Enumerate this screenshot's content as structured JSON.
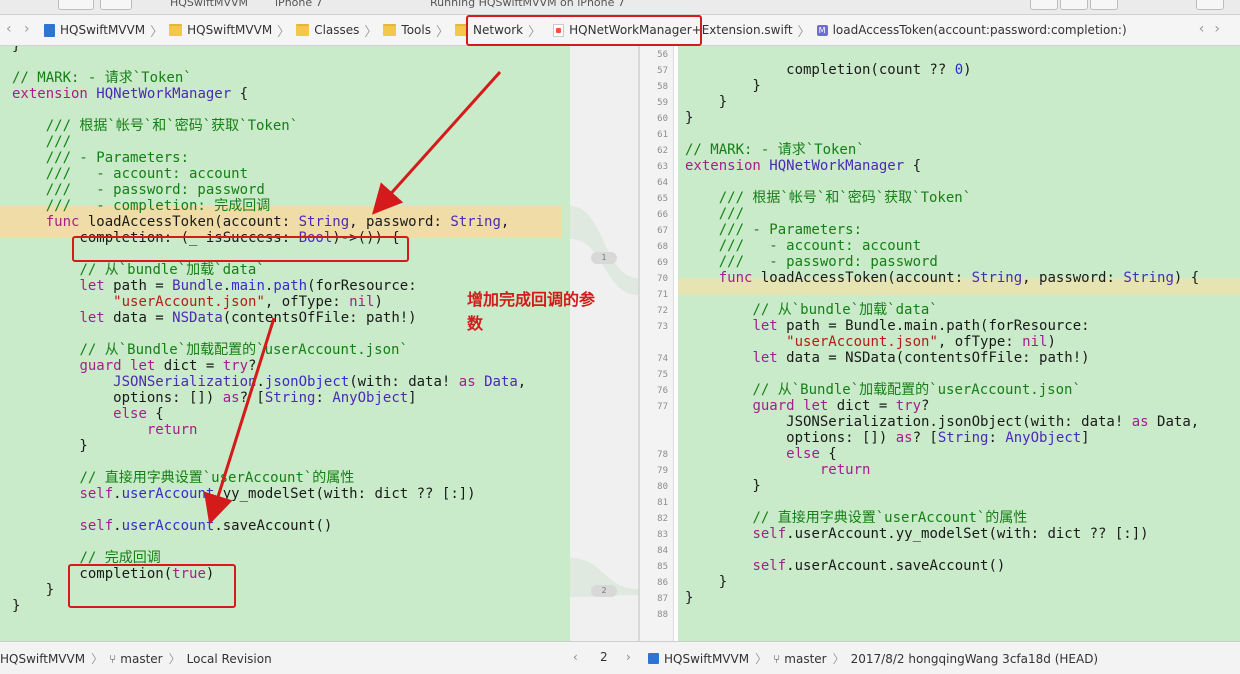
{
  "toolbar": {
    "scheme_text": "HQSwiftMVVM",
    "device_text": "iPhone 7",
    "status_text": "Running HQSwiftMVVM on iPhone 7"
  },
  "jumpbar": {
    "crumbs": [
      {
        "label": "HQSwiftMVVM",
        "icon": "project-icon"
      },
      {
        "label": "HQSwiftMVVM",
        "icon": "folder-icon"
      },
      {
        "label": "Classes",
        "icon": "folder-icon"
      },
      {
        "label": "Tools",
        "icon": "folder-icon"
      },
      {
        "label": "Network",
        "icon": "folder-icon"
      },
      {
        "label": "HQNetWorkManager+Extension.swift",
        "icon": "swift-file-icon"
      },
      {
        "label": "loadAccessToken(account:password:completion:)",
        "icon": "method-icon"
      }
    ]
  },
  "changes": {
    "first": "1",
    "second": "2"
  },
  "annotation": {
    "line1": "增加完成回调的参",
    "line2": "数"
  },
  "left_code": [
    {
      "t": "}"
    },
    {
      "t": ""
    },
    {
      "s": [
        [
          "cm",
          "// MARK: - 请求`Token`"
        ]
      ]
    },
    {
      "s": [
        [
          "kw",
          "extension "
        ],
        [
          "ty",
          "HQNetWorkManager"
        ],
        [
          "",
          " {"
        ]
      ]
    },
    {
      "t": ""
    },
    {
      "s": [
        [
          "",
          "    "
        ],
        [
          "cm",
          "/// 根据`帐号`和`密码`获取`Token`"
        ]
      ]
    },
    {
      "s": [
        [
          "",
          "    "
        ],
        [
          "cm",
          "///"
        ]
      ]
    },
    {
      "s": [
        [
          "",
          "    "
        ],
        [
          "cm",
          "/// - Parameters:"
        ]
      ]
    },
    {
      "s": [
        [
          "",
          "    "
        ],
        [
          "cm",
          "///   - account: account"
        ]
      ]
    },
    {
      "s": [
        [
          "",
          "    "
        ],
        [
          "cm",
          "///   - password: password"
        ]
      ]
    },
    {
      "s": [
        [
          "",
          "    "
        ],
        [
          "cm",
          "///   - completion: 完成回调"
        ]
      ]
    },
    {
      "s": [
        [
          "",
          "    "
        ],
        [
          "kw",
          "func "
        ],
        [
          "",
          "loadAccessToken(account: "
        ],
        [
          "ty",
          "String"
        ],
        [
          "",
          ", password: "
        ],
        [
          "ty",
          "String"
        ],
        [
          "",
          ","
        ]
      ]
    },
    {
      "s": [
        [
          "",
          "        completion: (_ isSuccess: "
        ],
        [
          "ty",
          "Bool"
        ],
        [
          "",
          ")->()) {"
        ]
      ]
    },
    {
      "t": ""
    },
    {
      "s": [
        [
          "",
          "        "
        ],
        [
          "cm",
          "// 从`bundle`加载`data`"
        ]
      ]
    },
    {
      "s": [
        [
          "",
          "        "
        ],
        [
          "kw",
          "let "
        ],
        [
          "",
          "path = "
        ],
        [
          "ty",
          "Bundle"
        ],
        [
          "",
          "."
        ],
        [
          "fn",
          "main"
        ],
        [
          "",
          "."
        ],
        [
          "fn",
          "path"
        ],
        [
          "",
          "(forResource:"
        ]
      ]
    },
    {
      "s": [
        [
          "",
          "            "
        ],
        [
          "st",
          "\"userAccount.json\""
        ],
        [
          "",
          ", ofType: "
        ],
        [
          "kw",
          "nil"
        ],
        [
          "",
          ")"
        ]
      ]
    },
    {
      "s": [
        [
          "",
          "        "
        ],
        [
          "kw",
          "let "
        ],
        [
          "",
          "data = "
        ],
        [
          "ty",
          "NSData"
        ],
        [
          "",
          "(contentsOfFile: path!)"
        ]
      ]
    },
    {
      "t": ""
    },
    {
      "s": [
        [
          "",
          "        "
        ],
        [
          "cm",
          "// 从`Bundle`加载配置的`userAccount.json`"
        ]
      ]
    },
    {
      "s": [
        [
          "",
          "        "
        ],
        [
          "kw",
          "guard let "
        ],
        [
          "",
          "dict = "
        ],
        [
          "kw",
          "try"
        ],
        [
          "",
          "?"
        ]
      ]
    },
    {
      "s": [
        [
          "",
          "            "
        ],
        [
          "ty",
          "JSONSerialization"
        ],
        [
          "",
          "."
        ],
        [
          "fn",
          "jsonObject"
        ],
        [
          "",
          "(with: data! "
        ],
        [
          "kw",
          "as "
        ],
        [
          "ty",
          "Data"
        ],
        [
          "",
          ","
        ]
      ]
    },
    {
      "s": [
        [
          "",
          "            options: []) "
        ],
        [
          "kw",
          "as"
        ],
        [
          "",
          "? ["
        ],
        [
          "ty",
          "String"
        ],
        [
          "",
          ": "
        ],
        [
          "ty",
          "AnyObject"
        ],
        [
          "",
          "]"
        ]
      ]
    },
    {
      "s": [
        [
          "",
          "            "
        ],
        [
          "kw",
          "else"
        ],
        [
          "",
          " {"
        ]
      ]
    },
    {
      "s": [
        [
          "",
          "                "
        ],
        [
          "kw",
          "return"
        ]
      ]
    },
    {
      "t": "        }"
    },
    {
      "t": ""
    },
    {
      "s": [
        [
          "",
          "        "
        ],
        [
          "cm",
          "// 直接用字典设置`userAccount`的属性"
        ]
      ]
    },
    {
      "s": [
        [
          "",
          "        "
        ],
        [
          "kw",
          "self"
        ],
        [
          "",
          "."
        ],
        [
          "fn",
          "userAccount"
        ],
        [
          "",
          ".yy_modelSet(with: dict ?? [:])"
        ]
      ]
    },
    {
      "t": ""
    },
    {
      "s": [
        [
          "",
          "        "
        ],
        [
          "kw",
          "self"
        ],
        [
          "",
          "."
        ],
        [
          "fn",
          "userAccount"
        ],
        [
          "",
          ".saveAccount()"
        ]
      ]
    },
    {
      "t": ""
    },
    {
      "s": [
        [
          "",
          "        "
        ],
        [
          "cm",
          "// 完成回调"
        ]
      ]
    },
    {
      "s": [
        [
          "",
          "        completion("
        ],
        [
          "kw",
          "true"
        ],
        [
          "",
          ")"
        ]
      ]
    },
    {
      "t": "    }"
    },
    {
      "t": "}"
    }
  ],
  "right_code": [
    {
      "n": "56",
      "t": ""
    },
    {
      "n": "57",
      "s": [
        [
          "",
          "            completion(count ?? "
        ],
        [
          "nm",
          "0"
        ],
        [
          "",
          ")"
        ]
      ]
    },
    {
      "n": "58",
      "t": "        }"
    },
    {
      "n": "59",
      "t": "    }"
    },
    {
      "n": "60",
      "t": "}"
    },
    {
      "n": "61",
      "t": ""
    },
    {
      "n": "62",
      "s": [
        [
          "cm",
          "// MARK: - 请求`Token`"
        ]
      ]
    },
    {
      "n": "63",
      "s": [
        [
          "kw",
          "extension "
        ],
        [
          "ty",
          "HQNetWorkManager"
        ],
        [
          "",
          " {"
        ]
      ]
    },
    {
      "n": "64",
      "t": ""
    },
    {
      "n": "65",
      "s": [
        [
          "",
          "    "
        ],
        [
          "cm",
          "/// 根据`帐号`和`密码`获取`Token`"
        ]
      ]
    },
    {
      "n": "66",
      "s": [
        [
          "",
          "    "
        ],
        [
          "cm",
          "///"
        ]
      ]
    },
    {
      "n": "67",
      "s": [
        [
          "",
          "    "
        ],
        [
          "cm",
          "/// - Parameters:"
        ]
      ]
    },
    {
      "n": "68",
      "s": [
        [
          "",
          "    "
        ],
        [
          "cm",
          "///   - account: account"
        ]
      ]
    },
    {
      "n": "69",
      "s": [
        [
          "",
          "    "
        ],
        [
          "cm",
          "///   - password: password"
        ]
      ]
    },
    {
      "n": "70",
      "s": [
        [
          "",
          "    "
        ],
        [
          "kw",
          "func "
        ],
        [
          "",
          "loadAccessToken(account: "
        ],
        [
          "ty",
          "String"
        ],
        [
          "",
          ", password: "
        ],
        [
          "ty",
          "String"
        ],
        [
          "",
          ") {"
        ]
      ]
    },
    {
      "n": "71",
      "t": ""
    },
    {
      "n": "72",
      "s": [
        [
          "",
          "        "
        ],
        [
          "cm",
          "// 从`bundle`加载`data`"
        ]
      ]
    },
    {
      "n": "73",
      "s": [
        [
          "",
          "        "
        ],
        [
          "kw",
          "let "
        ],
        [
          "",
          "path = Bundle.main.path(forResource:"
        ]
      ]
    },
    {
      "n": "",
      "s": [
        [
          "",
          "            "
        ],
        [
          "st",
          "\"userAccount.json\""
        ],
        [
          "",
          ", ofType: "
        ],
        [
          "kw",
          "nil"
        ],
        [
          "",
          ")"
        ]
      ]
    },
    {
      "n": "74",
      "s": [
        [
          "",
          "        "
        ],
        [
          "kw",
          "let "
        ],
        [
          "",
          "data = NSData(contentsOfFile: path!)"
        ]
      ]
    },
    {
      "n": "75",
      "t": ""
    },
    {
      "n": "76",
      "s": [
        [
          "",
          "        "
        ],
        [
          "cm",
          "// 从`Bundle`加载配置的`userAccount.json`"
        ]
      ]
    },
    {
      "n": "77",
      "s": [
        [
          "",
          "        "
        ],
        [
          "kw",
          "guard let "
        ],
        [
          "",
          "dict = "
        ],
        [
          "kw",
          "try"
        ],
        [
          "",
          "?"
        ]
      ]
    },
    {
      "n": "",
      "s": [
        [
          "",
          "            JSONSerialization.jsonObject(with: data! "
        ],
        [
          "kw",
          "as "
        ],
        [
          "",
          "Data,"
        ]
      ]
    },
    {
      "n": "",
      "s": [
        [
          "",
          "            options: []) "
        ],
        [
          "kw",
          "as"
        ],
        [
          "",
          "? ["
        ],
        [
          "ty",
          "String"
        ],
        [
          "",
          ": "
        ],
        [
          "ty",
          "AnyObject"
        ],
        [
          "",
          "]"
        ]
      ]
    },
    {
      "n": "78",
      "s": [
        [
          "",
          "            "
        ],
        [
          "kw",
          "else"
        ],
        [
          "",
          " {"
        ]
      ]
    },
    {
      "n": "79",
      "s": [
        [
          "",
          "                "
        ],
        [
          "kw",
          "return"
        ]
      ]
    },
    {
      "n": "80",
      "t": "        }"
    },
    {
      "n": "81",
      "t": ""
    },
    {
      "n": "82",
      "s": [
        [
          "",
          "        "
        ],
        [
          "cm",
          "// 直接用字典设置`userAccount`的属性"
        ]
      ]
    },
    {
      "n": "83",
      "s": [
        [
          "",
          "        "
        ],
        [
          "kw",
          "self"
        ],
        [
          "",
          ".userAccount.yy_modelSet(with: dict ?? [:])"
        ]
      ]
    },
    {
      "n": "84",
      "t": ""
    },
    {
      "n": "85",
      "s": [
        [
          "",
          "        "
        ],
        [
          "kw",
          "self"
        ],
        [
          "",
          ".userAccount.saveAccount()"
        ]
      ]
    },
    {
      "n": "86",
      "t": "    }"
    },
    {
      "n": "87",
      "t": "}"
    },
    {
      "n": "88",
      "t": ""
    }
  ],
  "bottom": {
    "left_project": "HQSwiftMVVM",
    "left_branch": "master",
    "left_revision": "Local Revision",
    "page_number": "2",
    "right_project": "HQSwiftMVVM",
    "right_branch": "master",
    "right_commit": "2017/8/2  hongqingWang  3cfa18d (HEAD)"
  },
  "colors": {
    "pane_bg": "#c9ebc9",
    "highlight": "#f0dca7",
    "annotation_red": "#d41a1a",
    "comment": "#167e16",
    "keyword": "#a61d8c",
    "type": "#4b2ab6",
    "string": "#b51d16"
  }
}
